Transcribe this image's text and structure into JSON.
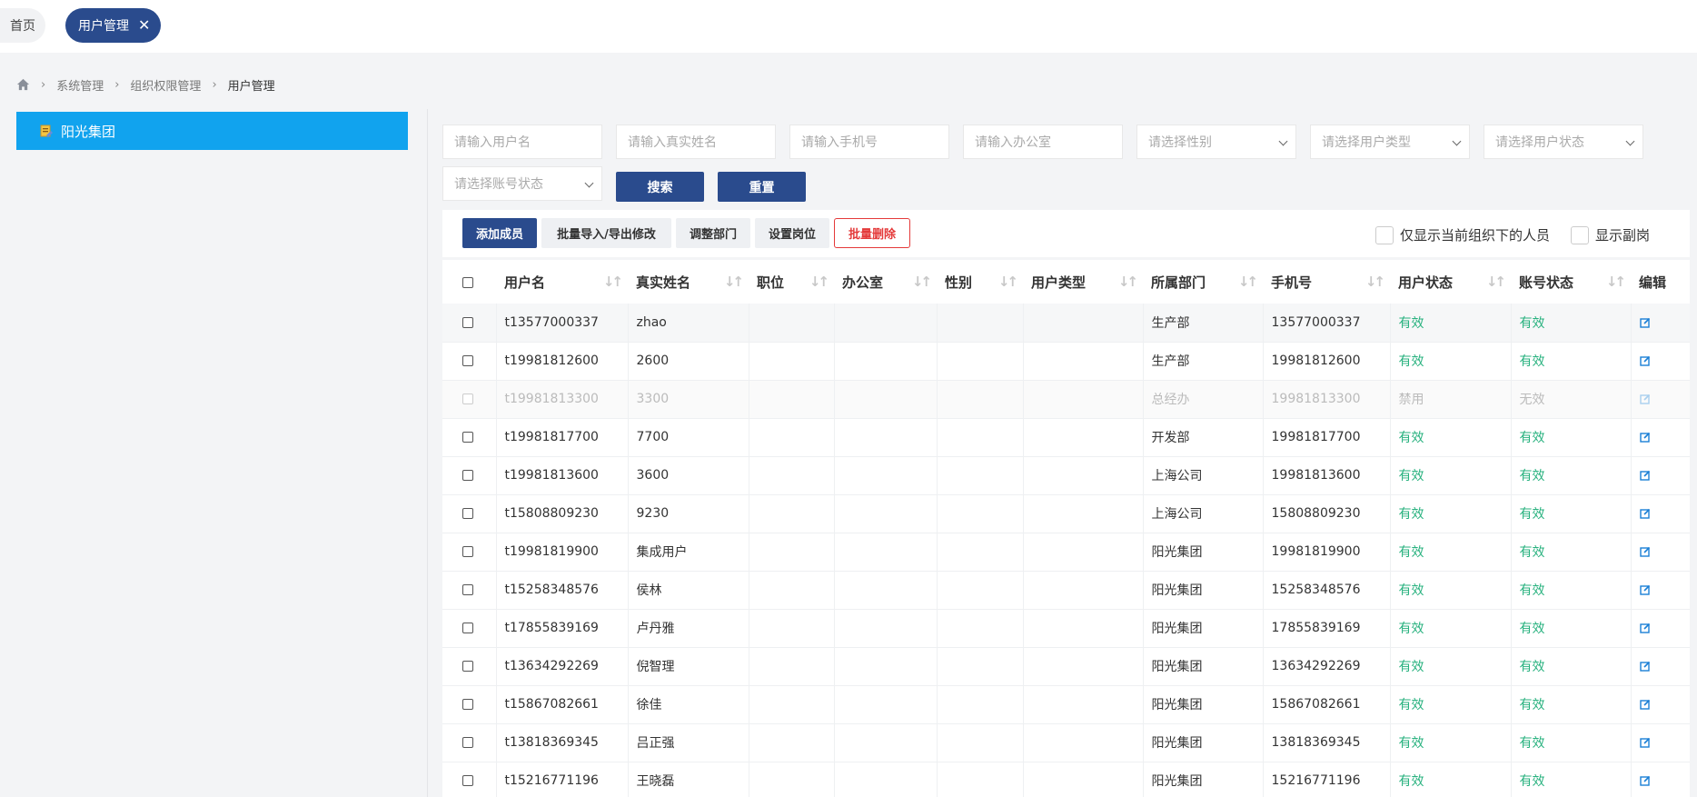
{
  "tabs": {
    "home": "首页",
    "active": "用户管理",
    "close_glyph": "✕"
  },
  "breadcrumb": [
    "系统管理",
    "组织权限管理",
    "用户管理"
  ],
  "tree": {
    "root": "阳光集团"
  },
  "filters": {
    "username": "请输入用户名",
    "realname": "请输入真实姓名",
    "phone": "请输入手机号",
    "office": "请输入办公室",
    "gender": "请选择性别",
    "user_type": "请选择用户类型",
    "user_status": "请选择用户状态",
    "account_status": "请选择账号状态",
    "search": "搜索",
    "reset": "重置"
  },
  "toolbar": {
    "add": "添加成员",
    "batch": "批量导入/导出修改",
    "dept": "调整部门",
    "post": "设置岗位",
    "delete": "批量删除",
    "only_current": "仅显示当前组织下的人员",
    "show_deputy": "显示副岗"
  },
  "table": {
    "headers": [
      "用户名",
      "真实姓名",
      "职位",
      "办公室",
      "性别",
      "用户类型",
      "所属部门",
      "手机号",
      "用户状态",
      "账号状态",
      "编辑"
    ],
    "rows": [
      {
        "username": "t13577000337",
        "realname": "zhao",
        "dept": "生产部",
        "phone": "13577000337",
        "ustatus": "有效",
        "astatus": "有效",
        "disabled": false
      },
      {
        "username": "t19981812600",
        "realname": "2600",
        "dept": "生产部",
        "phone": "19981812600",
        "ustatus": "有效",
        "astatus": "有效",
        "disabled": false
      },
      {
        "username": "t19981813300",
        "realname": "3300",
        "dept": "总经办",
        "phone": "19981813300",
        "ustatus": "禁用",
        "astatus": "无效",
        "disabled": true
      },
      {
        "username": "t19981817700",
        "realname": "7700",
        "dept": "开发部",
        "phone": "19981817700",
        "ustatus": "有效",
        "astatus": "有效",
        "disabled": false
      },
      {
        "username": "t19981813600",
        "realname": "3600",
        "dept": "上海公司",
        "phone": "19981813600",
        "ustatus": "有效",
        "astatus": "有效",
        "disabled": false
      },
      {
        "username": "t15808809230",
        "realname": "9230",
        "dept": "上海公司",
        "phone": "15808809230",
        "ustatus": "有效",
        "astatus": "有效",
        "disabled": false
      },
      {
        "username": "t19981819900",
        "realname": "集成用户",
        "dept": "阳光集团",
        "phone": "19981819900",
        "ustatus": "有效",
        "astatus": "有效",
        "disabled": false
      },
      {
        "username": "t15258348576",
        "realname": "侯林",
        "dept": "阳光集团",
        "phone": "15258348576",
        "ustatus": "有效",
        "astatus": "有效",
        "disabled": false
      },
      {
        "username": "t17855839169",
        "realname": "卢丹雅",
        "dept": "阳光集团",
        "phone": "17855839169",
        "ustatus": "有效",
        "astatus": "有效",
        "disabled": false
      },
      {
        "username": "t13634292269",
        "realname": "倪智理",
        "dept": "阳光集团",
        "phone": "13634292269",
        "ustatus": "有效",
        "astatus": "有效",
        "disabled": false
      },
      {
        "username": "t15867082661",
        "realname": "徐佳",
        "dept": "阳光集团",
        "phone": "15867082661",
        "ustatus": "有效",
        "astatus": "有效",
        "disabled": false
      },
      {
        "username": "t13818369345",
        "realname": "吕正强",
        "dept": "阳光集团",
        "phone": "13818369345",
        "ustatus": "有效",
        "astatus": "有效",
        "disabled": false
      },
      {
        "username": "t15216771196",
        "realname": "王晓磊",
        "dept": "阳光集团",
        "phone": "15216771196",
        "ustatus": "有效",
        "astatus": "有效",
        "disabled": false
      }
    ]
  },
  "colors": {
    "primary": "#2a4b8d",
    "tree_selected": "#11a3ee",
    "ok": "#27b17e",
    "ban": "#e9b48a",
    "danger": "#e43a3a"
  }
}
